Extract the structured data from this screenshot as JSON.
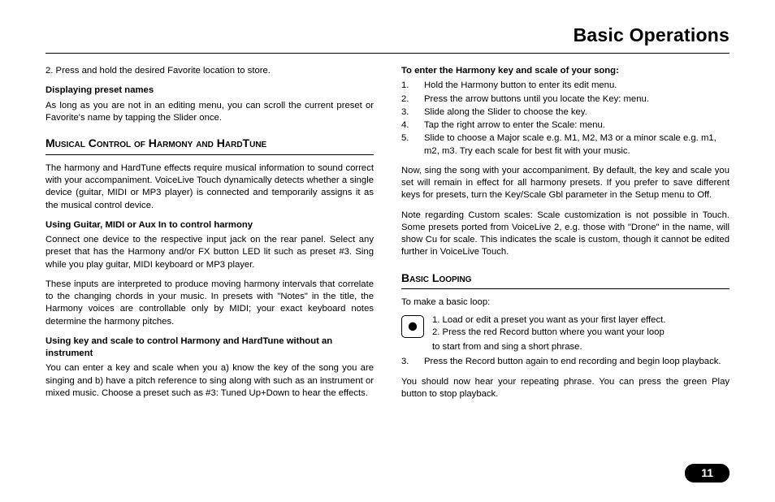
{
  "header": "Basic Operations",
  "page_number": "11",
  "left": {
    "p1": "2. Press and hold the desired Favorite location to store.",
    "h1": "Displaying preset names",
    "p2": "As long as you are not in an editing menu, you can scroll the current preset or Favorite's name by tapping the Slider once.",
    "sec1": "Musical Control of Harmony and HardTune",
    "p3": "The harmony and HardTune effects require musical information to sound correct with your accompaniment. VoiceLive Touch dynamically detects whether a single device (guitar, MIDI or MP3 player) is connected and temporarily assigns it as the musical control device.",
    "h2": "Using Guitar, MIDI or Aux In to control harmony",
    "p4": "Connect one device to the respective input jack on the rear panel. Select any preset that has the Harmony and/or FX button LED lit such as preset #3. Sing while you play guitar, MIDI keyboard or MP3 player.",
    "p5": "These inputs are interpreted to produce moving harmony intervals that correlate to the changing chords in your music. In presets with \"Notes\" in the title, the Harmony voices are controllable only by MIDI; your exact keyboard notes determine the harmony pitches.",
    "h3": "Using key and scale to control Harmony and HardTune without an instrument",
    "p6": "You can enter a key and scale when you a) know the key of the song you are singing and b) have a pitch reference to sing along with such as an instrument or mixed music. Choose a preset such as #3: Tuned Up+Down to hear the effects."
  },
  "right": {
    "h1": "To enter the Harmony key and scale of your song:",
    "steps": [
      "Hold the Harmony button to enter its edit menu.",
      "Press the arrow buttons until you locate the Key: menu.",
      "Slide along the Slider to choose the key.",
      "Tap the right arrow to enter the Scale: menu.",
      "Slide to choose a Major scale e.g. M1, M2, M3 or a minor scale e.g. m1, m2, m3. Try each scale for best fit with your music."
    ],
    "p1": "Now, sing the song with your accompaniment. By default, the key and scale you set will remain in effect for all harmony presets. If you prefer to save different keys for presets, turn the Key/Scale Gbl parameter in the Setup menu to Off.",
    "p2": "Note regarding Custom scales: Scale customization is not possible in Touch. Some presets ported from VoiceLive 2, e.g. those with \"Drone\" in the name, will show Cu for scale. This indicates the scale is custom, though it cannot be edited further in VoiceLive Touch.",
    "sec1": "Basic Looping",
    "h2": "To make a basic loop:",
    "loop1": "1. Load or edit a preset you want as your first layer effect.",
    "loop2a": "2. Press the red Record button where you want your loop",
    "loop2b": "to start from and sing a short phrase.",
    "loop3num": "3.",
    "loop3": "Press the Record button again to end recording and begin loop playback.",
    "p3": "You should now hear your repeating phrase. You can press the green Play button to stop playback."
  }
}
